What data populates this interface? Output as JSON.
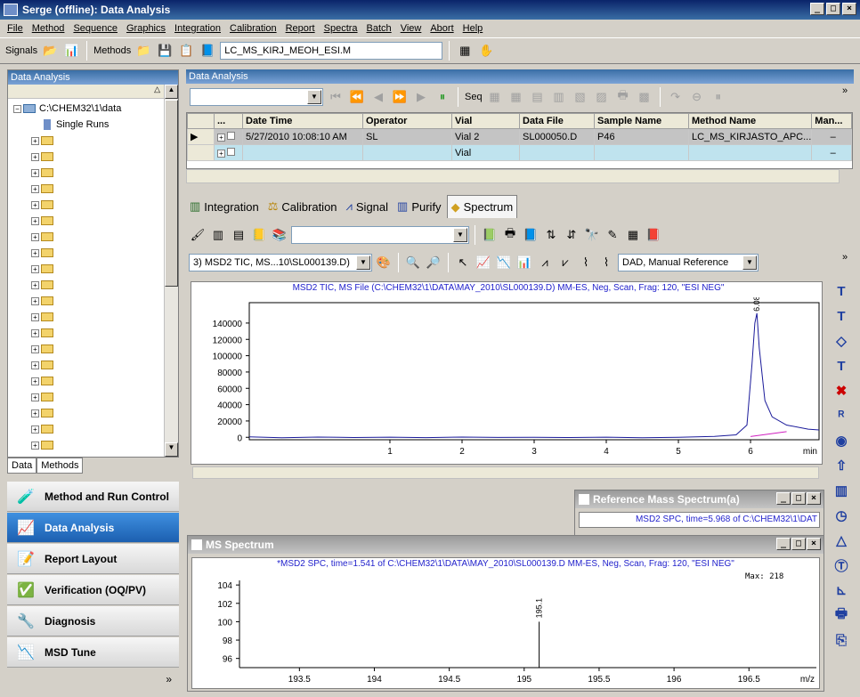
{
  "window": {
    "title": "Serge (offline): Data Analysis"
  },
  "menu": [
    "File",
    "Method",
    "Sequence",
    "Graphics",
    "Integration",
    "Calibration",
    "Report",
    "Spectra",
    "Batch",
    "View",
    "Abort",
    "Help"
  ],
  "toolbar": {
    "signals_label": "Signals",
    "methods_label": "Methods",
    "method_file": "LC_MS_KIRJ_MEOH_ESI.M"
  },
  "left_panel": {
    "title": "Data Analysis",
    "root": "C:\\CHEM32\\1\\data",
    "single_runs": "Single Runs",
    "tabs": [
      "Data",
      "Methods"
    ]
  },
  "nav": [
    "Method and Run Control",
    "Data Analysis",
    "Report Layout",
    "Verification (OQ/PV)",
    "Diagnosis",
    "MSD Tune"
  ],
  "data_analysis": {
    "title": "Data Analysis",
    "seq_label": "Seq",
    "columns": [
      "...",
      "Date Time",
      "Operator",
      "Vial",
      "Data File",
      "Sample Name",
      "Method Name",
      "Man..."
    ],
    "rows": [
      {
        "date": "5/27/2010 10:08:10 AM",
        "operator": "SL",
        "vial": "Vial 2",
        "file": "SL000050.D",
        "sample": "P46",
        "method": "LC_MS_KIRJASTO_APC...",
        "man": "–"
      },
      {
        "date": "",
        "operator": "",
        "vial": "Vial",
        "file": "",
        "sample": "",
        "method": "",
        "man": "–"
      }
    ]
  },
  "tabs": [
    "Integration",
    "Calibration",
    "Signal",
    "Purify",
    "Spectrum"
  ],
  "signal_select": "3) MSD2 TIC, MS...10\\SL000139.D)",
  "reference_select": "DAD, Manual Reference",
  "tic_chart": {
    "title": "MSD2 TIC, MS File (C:\\CHEM32\\1\\DATA\\MAY_2010\\SL000139.D)    MM-ES, Neg, Scan, Frag: 120, \"ESI NEG\"",
    "peak_label": "6.089",
    "xunit": "min"
  },
  "chart_data": [
    {
      "type": "line",
      "title": "MSD2 TIC, MS File (C:\\CHEM32\\1\\DATA\\MAY_2010\\SL000139.D)    MM-ES, Neg, Scan, Frag: 120, \"ESI NEG\"",
      "xlabel": "min",
      "ylabel": "",
      "xlim": [
        -0.95,
        6.95
      ],
      "ylim": [
        -3000,
        165000
      ],
      "xticks": [
        1,
        2,
        3,
        4,
        5,
        6
      ],
      "yticks": [
        0,
        20000,
        40000,
        60000,
        80000,
        100000,
        120000,
        140000
      ],
      "series": [
        {
          "x": [
            -0.95,
            -0.5,
            0,
            0.5,
            1,
            1.5,
            2,
            2.5,
            3,
            3.5,
            4,
            4.5,
            5,
            5.5,
            5.8,
            5.95,
            6.02,
            6.06,
            6.089,
            6.12,
            6.2,
            6.3,
            6.5,
            6.8,
            6.95
          ],
          "y": [
            500,
            -500,
            300,
            -300,
            200,
            -400,
            300,
            -200,
            0,
            -300,
            200,
            -500,
            0,
            1000,
            3000,
            15000,
            90000,
            140000,
            152000,
            110000,
            45000,
            25000,
            15000,
            10000,
            9000
          ]
        }
      ]
    },
    {
      "type": "bar",
      "title": "*MSD2 SPC, time=1.541 of C:\\CHEM32\\1\\DATA\\MAY_2010\\SL000139.D    MM-ES, Neg, Scan, Frag: 120, \"ESI NEG\"",
      "xlabel": "m/z",
      "ylabel": "",
      "xlim": [
        193.1,
        196.95
      ],
      "ylim": [
        95,
        104.5
      ],
      "xticks": [
        193.5,
        194,
        194.5,
        195,
        195.5,
        196,
        196.5
      ],
      "yticks": [
        96,
        98,
        100,
        102,
        104
      ],
      "x": [
        195.1
      ],
      "values": [
        100
      ],
      "labels": [
        "195.1"
      ]
    }
  ],
  "reference_window": {
    "title": "Reference Mass Spectrum(a)",
    "subtitle": "MSD2 SPC, time=5.968 of C:\\CHEM32\\1\\DAT"
  },
  "ms_window": {
    "title": "MS Spectrum",
    "max_label": "Max: 218",
    "xunit": "m/z"
  }
}
